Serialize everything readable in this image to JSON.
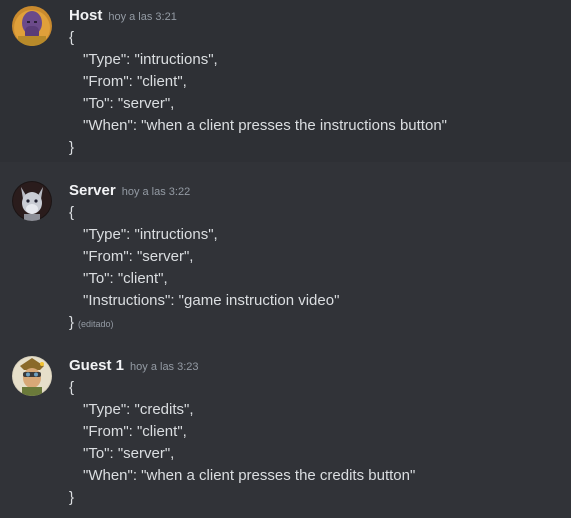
{
  "messages": [
    {
      "author": "Host",
      "timestamp": "hoy a las 3:21",
      "avatar_icon": "purple-titan-avatar",
      "open_brace": "{",
      "lines": [
        "\"Type\": \"intructions\",",
        "\"From\": \"client\",",
        "\"To\": \"server\",",
        "\"When\": \"when a client presses the instructions button\""
      ],
      "close_brace": "}",
      "edited": ""
    },
    {
      "author": "Server",
      "timestamp": "hoy a las 3:22",
      "avatar_icon": "grey-creature-avatar",
      "open_brace": "{",
      "lines": [
        "\"Type\": \"intructions\",",
        "\"From\": \"server\",",
        "\"To\": \"client\",",
        "\"Instructions\": \"game instruction video\""
      ],
      "close_brace": "}",
      "edited": "(editado)"
    },
    {
      "author": "Guest 1",
      "timestamp": "hoy a las 3:23",
      "avatar_icon": "goggles-character-avatar",
      "open_brace": "{",
      "lines": [
        "\"Type\": \"credits\",",
        "\"From\": \"client\",",
        "\"To\": \"server\",",
        "\"When\": \"when a client presses the credits button\""
      ],
      "close_brace": "}",
      "edited": ""
    }
  ]
}
